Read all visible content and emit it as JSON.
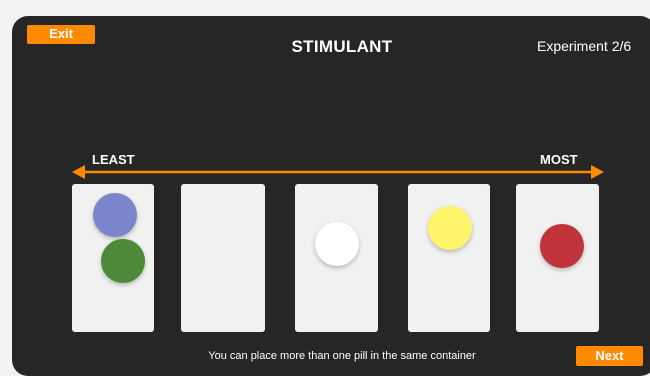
{
  "header": {
    "exit_label": "Exit",
    "title": "STIMULANT",
    "progress": "Experiment 2/6"
  },
  "scale": {
    "least_label": "LEAST",
    "most_label": "MOST",
    "arrow_color": "#ff8a00"
  },
  "containers": [
    {
      "pills": [
        "blue",
        "green"
      ]
    },
    {
      "pills": []
    },
    {
      "pills": [
        "white"
      ]
    },
    {
      "pills": [
        "yellow"
      ]
    },
    {
      "pills": [
        "red"
      ]
    }
  ],
  "pill_colors": {
    "blue": "#7a86c9",
    "green": "#4c8a39",
    "white": "#ffffff",
    "yellow": "#fff56b",
    "red": "#c1333b"
  },
  "footer": {
    "hint": "You can place more than one pill in the same container",
    "next_label": "Next"
  },
  "colors": {
    "accent": "#ff8a00",
    "panel": "#262626",
    "container": "#f1f1f1"
  }
}
